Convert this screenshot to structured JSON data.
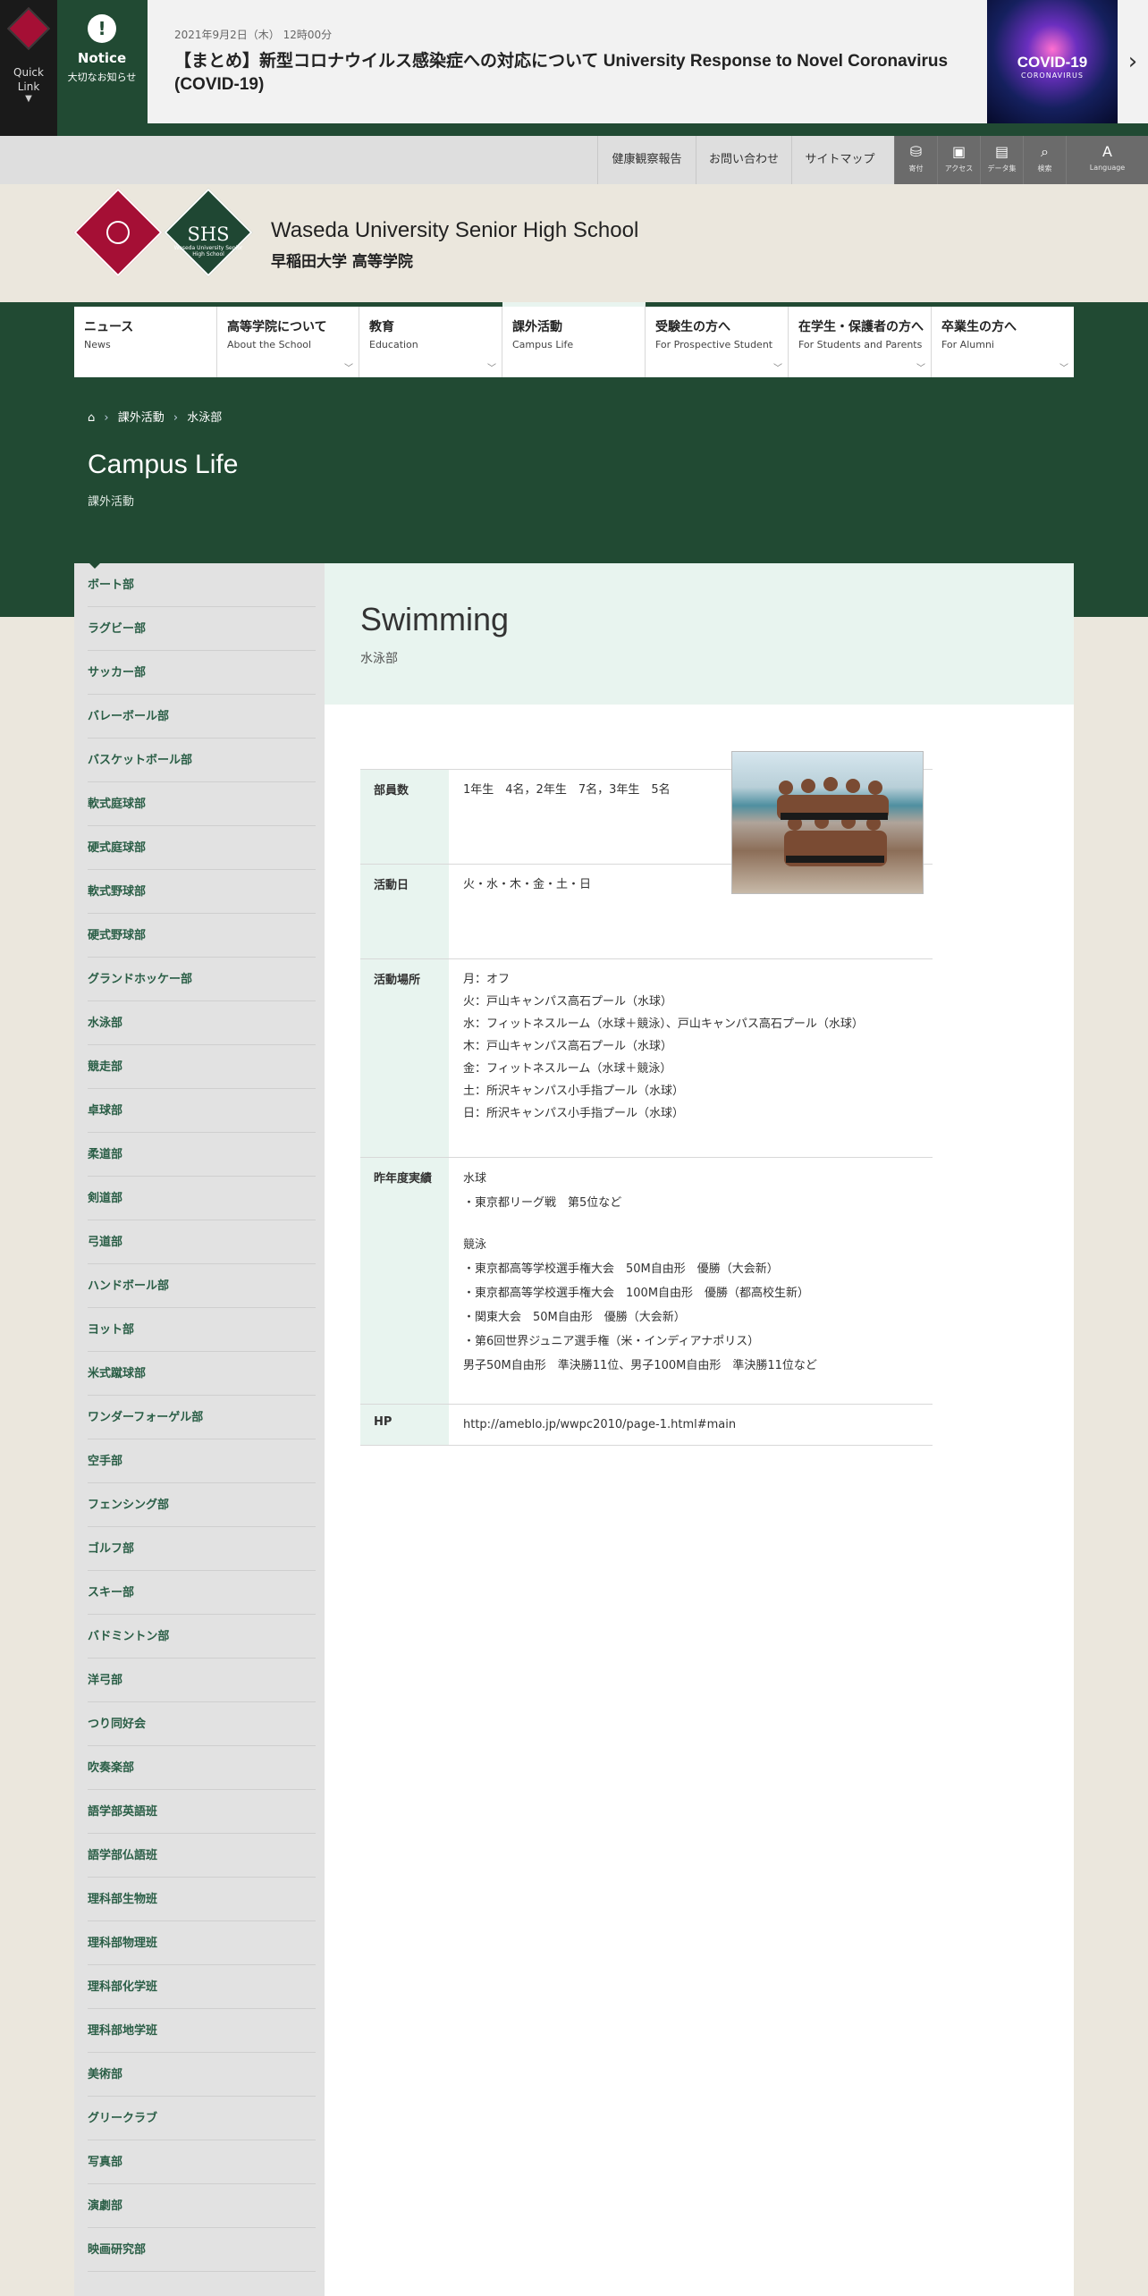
{
  "notice": {
    "quick_link": "Quick Link",
    "label_en": "Notice",
    "label_jp": "大切なお知らせ",
    "date": "2021年9月2日（木） 12時00分",
    "title": "【まとめ】新型コロナウイルス感染症への対応について University Response to Novel Coronavirus (COVID-19)",
    "image_title": "COVID-19",
    "image_sub": "CORONAVIRUS",
    "next_icon": "chevron-right-icon"
  },
  "utility": {
    "links": [
      "健康観察報告",
      "お問い合わせ",
      "サイトマップ"
    ],
    "icons": [
      {
        "icon": "donate-icon",
        "label": "寄付"
      },
      {
        "icon": "bus-icon",
        "label": "アクセス"
      },
      {
        "icon": "book-icon",
        "label": "データ集"
      },
      {
        "icon": "search-icon",
        "label": "検索"
      },
      {
        "icon": "language-icon",
        "label": "Language"
      }
    ]
  },
  "header": {
    "logo_shs": "SHS",
    "logo_shs_sub": "Waseda University Senior High School",
    "site_name_en": "Waseda University Senior High School",
    "site_name_jp": "早稲田大学 高等学院"
  },
  "nav": [
    {
      "jp": "ニュース",
      "en": "News"
    },
    {
      "jp": "高等学院について",
      "en": "About the School"
    },
    {
      "jp": "教育",
      "en": "Education"
    },
    {
      "jp": "課外活動",
      "en": "Campus Life"
    },
    {
      "jp": "受験生の方へ",
      "en": "For Prospective Student"
    },
    {
      "jp": "在学生・保護者の方へ",
      "en": "For Students and Parents"
    },
    {
      "jp": "卒業生の方へ",
      "en": "For Alumni"
    }
  ],
  "breadcrumb": {
    "home_icon": "home-icon",
    "level1": "課外活動",
    "level2": "水泳部"
  },
  "page": {
    "heading_en": "Campus Life",
    "heading_jp": "課外活動"
  },
  "sidebar": [
    "ボート部",
    "ラグビー部",
    "サッカー部",
    "バレーボール部",
    "バスケットボール部",
    "軟式庭球部",
    "硬式庭球部",
    "軟式野球部",
    "硬式野球部",
    "グランドホッケー部",
    "水泳部",
    "競走部",
    "卓球部",
    "柔道部",
    "剣道部",
    "弓道部",
    "ハンドボール部",
    "ヨット部",
    "米式蹴球部",
    "ワンダーフォーゲル部",
    "空手部",
    "フェンシング部",
    "ゴルフ部",
    "スキー部",
    "バドミントン部",
    "洋弓部",
    "つり同好会",
    "吹奏楽部",
    "語学部英語班",
    "語学部仏語班",
    "理科部生物班",
    "理科部物理班",
    "理科部化学班",
    "理科部地学班",
    "美術部",
    "グリークラブ",
    "写真部",
    "演劇部",
    "映画研究部"
  ],
  "club": {
    "title_en": "Swimming",
    "title_jp": "水泳部",
    "rows": {
      "members": {
        "label": "部員数",
        "value": "1年生　4名，2年生　7名，3年生　5名"
      },
      "days": {
        "label": "活動日",
        "value": "火・水・木・金・土・日"
      },
      "places": {
        "label": "活動場所",
        "lines": [
          "月：オフ",
          "火：戸山キャンパス高石プール（水球）",
          "水：フィットネスルーム（水球＋競泳）、戸山キャンパス高石プール（水球）",
          "木：戸山キャンパス高石プール（水球）",
          "金：フィットネスルーム（水球＋競泳）",
          "土：所沢キャンパス小手指プール（水球）",
          "日：所沢キャンパス小手指プール（水球）"
        ]
      },
      "results": {
        "label": "昨年度実績",
        "lines": [
          "水球",
          "・東京都リーグ戦　第5位など",
          "",
          "競泳",
          "・東京都高等学校選手権大会　50M自由形　優勝（大会新）",
          "・東京都高等学校選手権大会　100M自由形　優勝（都高校生新）",
          "・関東大会　50M自由形　優勝（大会新）",
          "・第6回世界ジュニア選手権（米・インディアナポリス）",
          "男子50M自由形　準決勝11位、男子100M自由形　準決勝11位など"
        ]
      },
      "hp": {
        "label": "HP",
        "value": "http://ameblo.jp/wwpc2010/page-1.html#main"
      }
    }
  }
}
